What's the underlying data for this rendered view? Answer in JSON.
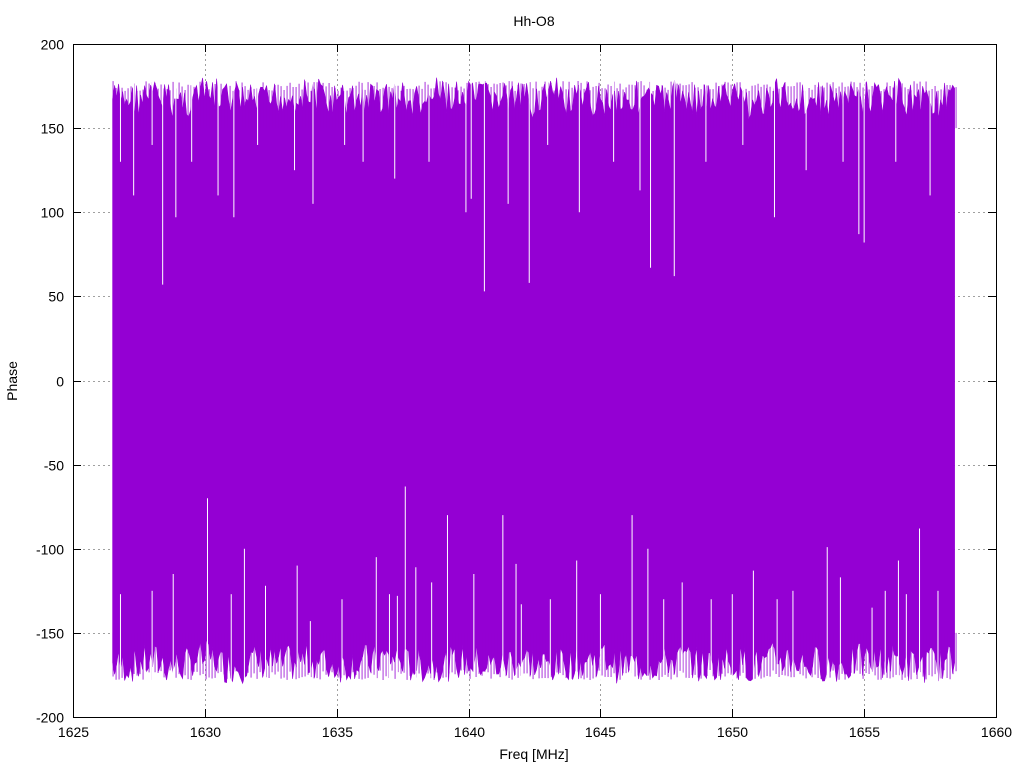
{
  "chart_data": {
    "type": "area",
    "title": "Hh-O8",
    "xlabel": "Freq [MHz]",
    "ylabel": "Phase",
    "xlim": [
      1625,
      1660
    ],
    "ylim": [
      -200,
      200
    ],
    "xticks": [
      1625,
      1630,
      1635,
      1640,
      1645,
      1650,
      1655,
      1660
    ],
    "yticks": [
      -200,
      -150,
      -100,
      -50,
      0,
      50,
      100,
      150,
      200
    ],
    "grid": true,
    "legend": "none",
    "series": [
      {
        "color": "#9400d3",
        "x_range": [
          1626.5,
          1658.5
        ],
        "band_min": [
          -180,
          -178,
          -180,
          -176,
          -180,
          -178,
          -179,
          -177,
          -180,
          -178,
          -176,
          -180,
          -179,
          -178,
          -180,
          -177,
          -180,
          -178,
          -176,
          -180,
          -179,
          -177,
          -180,
          -178,
          -180,
          -176,
          -179,
          -180,
          -178,
          -177,
          -180,
          -179,
          -176
        ],
        "band_max": [
          178,
          179,
          177,
          180,
          178,
          176,
          179,
          180,
          177,
          178,
          179,
          176,
          180,
          178,
          179,
          177,
          180,
          176,
          178,
          179,
          177,
          180,
          178,
          179,
          176,
          180,
          178,
          177,
          179,
          180,
          178,
          177,
          179
        ],
        "dips_from_top": [
          [
            1626.8,
            130
          ],
          [
            1627.3,
            110
          ],
          [
            1628.0,
            140
          ],
          [
            1628.4,
            57
          ],
          [
            1628.9,
            97
          ],
          [
            1629.5,
            130
          ],
          [
            1630.5,
            110
          ],
          [
            1631.1,
            97
          ],
          [
            1632.0,
            140
          ],
          [
            1633.4,
            125
          ],
          [
            1634.1,
            105
          ],
          [
            1635.3,
            140
          ],
          [
            1636.0,
            130
          ],
          [
            1637.2,
            120
          ],
          [
            1638.5,
            130
          ],
          [
            1639.9,
            100
          ],
          [
            1640.1,
            108
          ],
          [
            1640.6,
            53
          ],
          [
            1641.5,
            105
          ],
          [
            1642.3,
            58
          ],
          [
            1643.0,
            140
          ],
          [
            1644.2,
            100
          ],
          [
            1645.5,
            130
          ],
          [
            1646.5,
            113
          ],
          [
            1646.9,
            67
          ],
          [
            1647.8,
            62
          ],
          [
            1649.0,
            130
          ],
          [
            1650.4,
            140
          ],
          [
            1651.6,
            97
          ],
          [
            1652.8,
            125
          ],
          [
            1654.2,
            130
          ],
          [
            1654.8,
            87
          ],
          [
            1655.0,
            82
          ],
          [
            1656.2,
            130
          ],
          [
            1657.5,
            110
          ]
        ],
        "spikes_from_bottom": [
          [
            1626.8,
            -127
          ],
          [
            1628.0,
            -125
          ],
          [
            1628.8,
            -115
          ],
          [
            1630.1,
            -70
          ],
          [
            1631.0,
            -127
          ],
          [
            1631.5,
            -100
          ],
          [
            1632.3,
            -122
          ],
          [
            1633.5,
            -110
          ],
          [
            1634.0,
            -143
          ],
          [
            1635.2,
            -130
          ],
          [
            1636.5,
            -105
          ],
          [
            1637.0,
            -127
          ],
          [
            1637.3,
            -128
          ],
          [
            1637.6,
            -63
          ],
          [
            1638.0,
            -111
          ],
          [
            1638.6,
            -120
          ],
          [
            1639.2,
            -80
          ],
          [
            1640.2,
            -115
          ],
          [
            1641.3,
            -80
          ],
          [
            1641.8,
            -109
          ],
          [
            1642.0,
            -133
          ],
          [
            1643.1,
            -130
          ],
          [
            1644.1,
            -107
          ],
          [
            1645.0,
            -127
          ],
          [
            1646.2,
            -80
          ],
          [
            1646.8,
            -100
          ],
          [
            1647.4,
            -130
          ],
          [
            1648.1,
            -120
          ],
          [
            1649.2,
            -130
          ],
          [
            1650.0,
            -127
          ],
          [
            1650.8,
            -113
          ],
          [
            1651.7,
            -130
          ],
          [
            1652.3,
            -125
          ],
          [
            1653.6,
            -99
          ],
          [
            1654.1,
            -117
          ],
          [
            1655.3,
            -135
          ],
          [
            1655.8,
            -125
          ],
          [
            1656.3,
            -107
          ],
          [
            1656.6,
            -127
          ],
          [
            1657.1,
            -88
          ],
          [
            1657.8,
            -125
          ]
        ]
      }
    ]
  }
}
